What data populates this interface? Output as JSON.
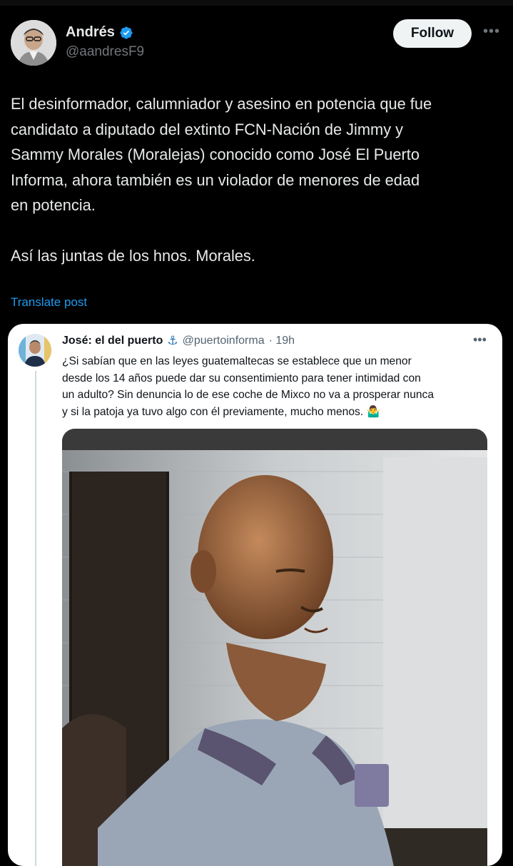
{
  "post": {
    "author": {
      "display_name": "Andrés",
      "handle": "@aandresF9",
      "verified_icon": "verified-badge-icon"
    },
    "follow_label": "Follow",
    "more_label": "•••",
    "text": "El desinformador, calumniador y asesino en potencia que fue\ncandidato a diputado del extinto FCN-Nación de Jimmy y\nSammy Morales (Moralejas) conocido como José El Puerto\nInforma, ahora también es un violador de menores de edad\nen potencia.\n\nAsí las juntas de los hnos. Morales.",
    "translate_label": "Translate post"
  },
  "quoted": {
    "display_name": "José: el del puerto",
    "anchor_emoji": "⚓",
    "handle": "@puertoinforma",
    "timestamp": "· 19h",
    "more_label": "•••",
    "text": "¿Si sabían que en las leyes guatemaltecas se establece que un menor\ndesde los 14 años puede dar su consentimiento para tener intimidad con\nun adulto? Sin denuncia lo de ese coche de Mixco no va a prosperar nunca\ny si la patoja ya tuvo algo con él previamente, mucho menos. 🤷‍♂️"
  },
  "colors": {
    "background": "#000000",
    "text": "#e7e9ea",
    "secondary": "#71767b",
    "link": "#1d9bf0",
    "verified": "#1d9bf0",
    "follow_bg": "#eff3f4",
    "card_bg": "#ffffff"
  }
}
